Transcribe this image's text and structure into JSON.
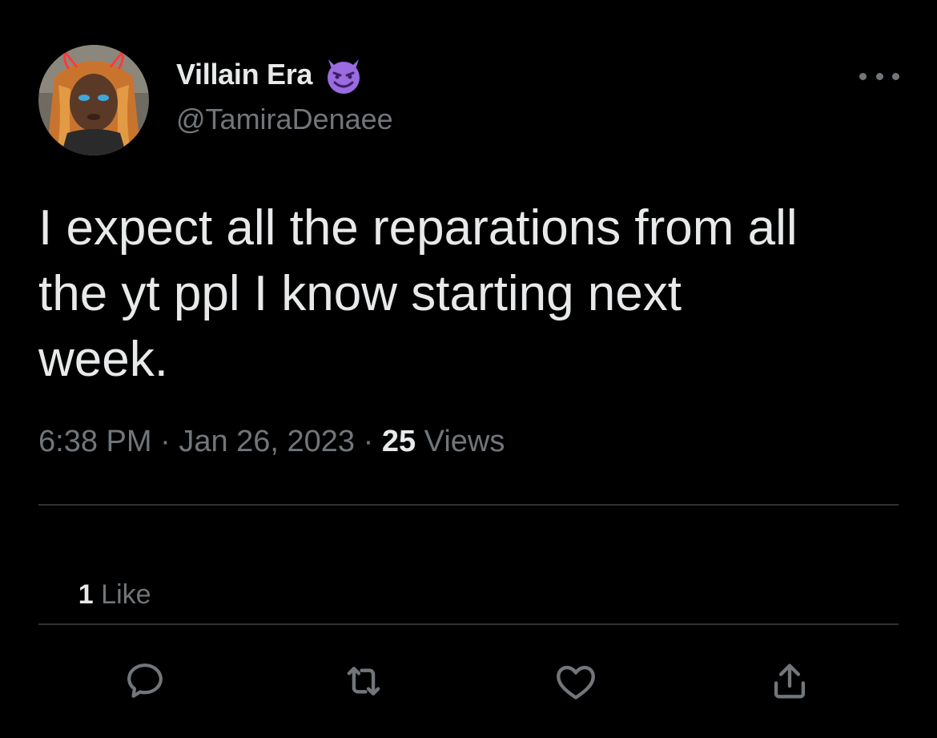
{
  "author": {
    "display_name": "Villain Era",
    "handle": "@TamiraDenaee",
    "name_emoji_icon": "smiling-devil-emoji"
  },
  "menu": {
    "more_icon": "more-horizontal-icon"
  },
  "tweet": {
    "text": "I expect all the reparations from all\nthe yt ppl I know starting next\nweek."
  },
  "meta": {
    "time": "6:38 PM",
    "separator": " · ",
    "date": "Jan 26, 2023",
    "views_count": "25",
    "views_label": " Views"
  },
  "engagement": {
    "likes_count": "1",
    "likes_label": " Like"
  },
  "actions": {
    "reply_icon": "reply-icon",
    "retweet_icon": "retweet-icon",
    "like_icon": "heart-icon",
    "share_icon": "share-icon"
  },
  "colors": {
    "background": "#000000",
    "primary_text": "#e7e9ea",
    "secondary_text": "#71767b",
    "divider": "#2f3336",
    "emoji": "#9b6be0"
  }
}
